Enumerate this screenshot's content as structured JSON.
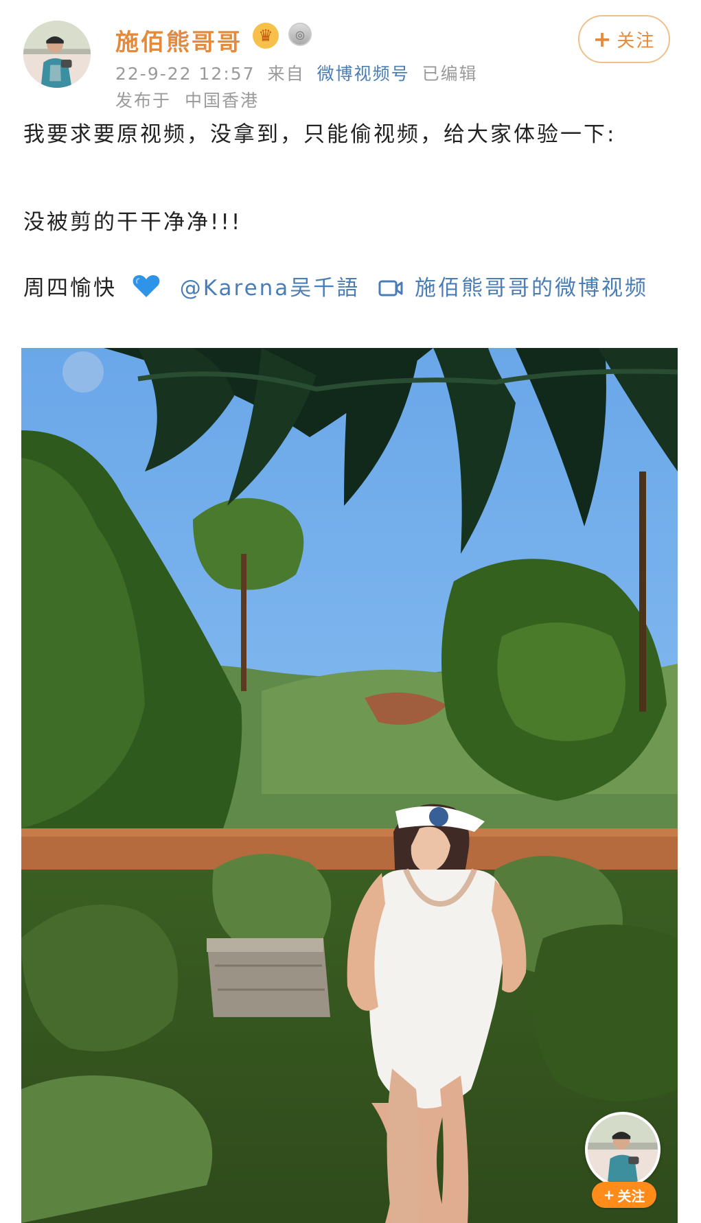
{
  "header": {
    "username": "施佰熊哥哥",
    "badges": {
      "crown": "crown-icon",
      "medal": "medal-icon"
    },
    "timestamp": "22-9-22 12:57",
    "source_prefix": "来自",
    "source": "微博视频号",
    "edited": "已编辑",
    "location_prefix": "发布于",
    "location": "中国香港",
    "follow_label": "关注"
  },
  "post": {
    "line1": "我要求要原视频，没拿到，只能偷视频，给大家体验一下:",
    "line2": "没被剪的干干净净!!!",
    "line3_prefix": "周四愉快",
    "mention": "@Karena吴千語",
    "video_link": "施佰熊哥哥的微博视频"
  },
  "floating": {
    "follow_label": "关注"
  },
  "colors": {
    "username": "#e58a3a",
    "link": "#4a7db6",
    "follow_orange": "#ff8b1b"
  },
  "icons": {
    "heart": "blue-heart-icon",
    "video": "video-icon",
    "plus": "plus-icon"
  }
}
